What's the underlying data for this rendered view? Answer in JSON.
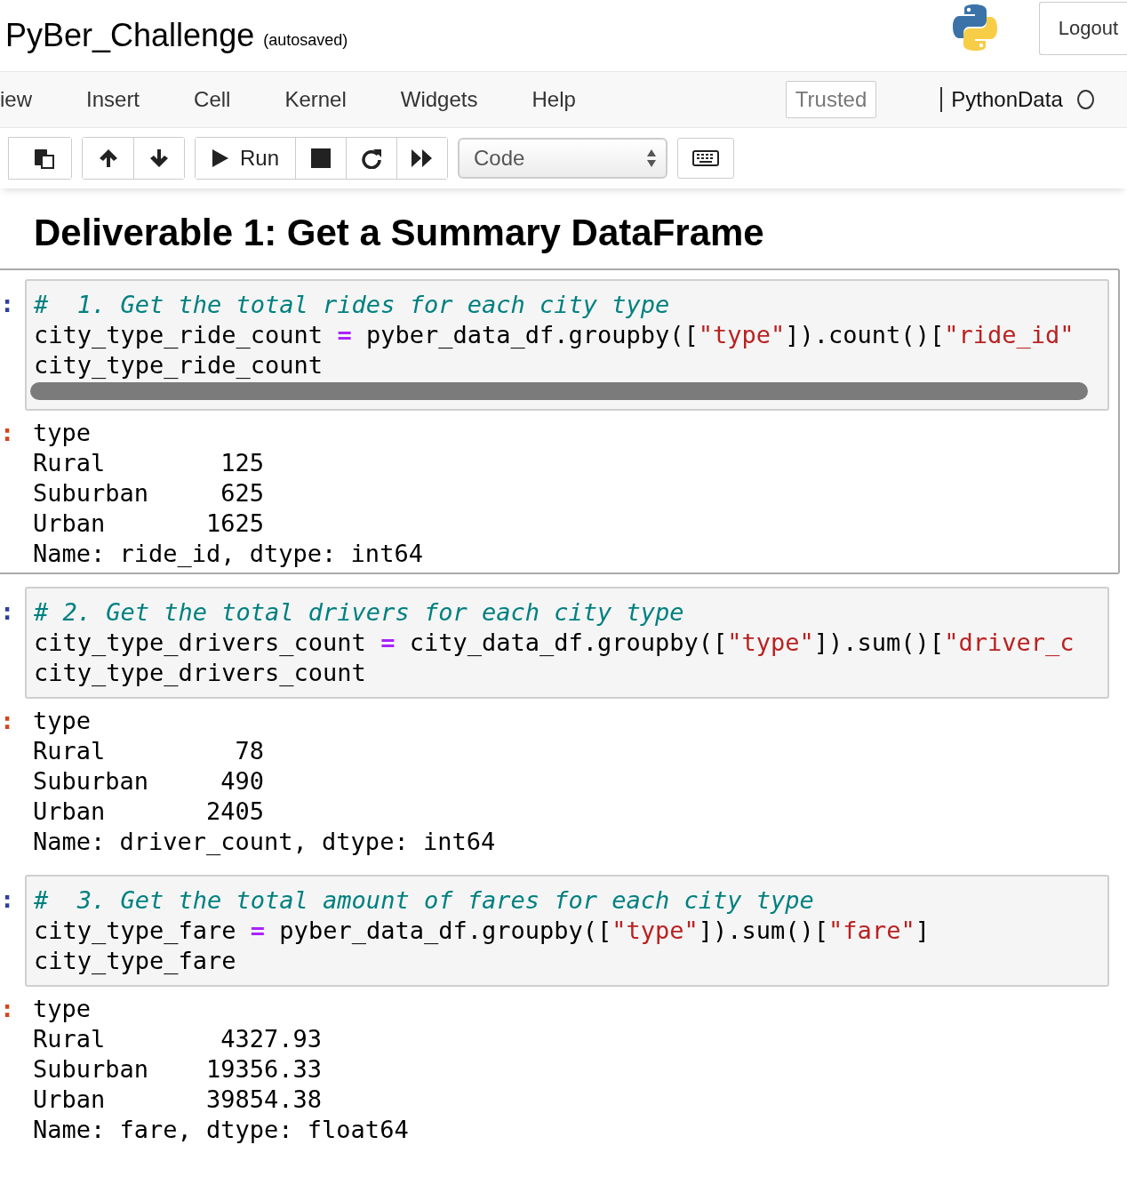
{
  "header": {
    "title": "PyBer_Challenge",
    "save_status": "(autosaved)",
    "logout": "Logout"
  },
  "menu": [
    "iew",
    "Insert",
    "Cell",
    "Kernel",
    "Widgets",
    "Help"
  ],
  "trusted": "Trusted",
  "kernel": "PythonData",
  "toolbar": {
    "run": "Run",
    "cell_type": "Code"
  },
  "heading": "Deliverable 1: Get a Summary DataFrame",
  "cells": [
    {
      "selected": true,
      "scrollbar": true,
      "in_prompt": ":",
      "out_prompt": ":",
      "code": [
        [
          {
            "kind": "comment",
            "text": "#  1. Get the total rides for each city type"
          }
        ],
        [
          {
            "kind": "plain",
            "text": "city_type_ride_count "
          },
          {
            "kind": "operator",
            "text": "="
          },
          {
            "kind": "plain",
            "text": " pyber_data_df.groupby(["
          },
          {
            "kind": "string",
            "text": "\"type\""
          },
          {
            "kind": "plain",
            "text": "]).count()["
          },
          {
            "kind": "string",
            "text": "\"ride_id\""
          }
        ],
        [
          {
            "kind": "plain",
            "text": "city_type_ride_count"
          }
        ]
      ],
      "output": [
        "type",
        "Rural        125",
        "Suburban     625",
        "Urban       1625",
        "Name: ride_id, dtype: int64"
      ]
    },
    {
      "selected": false,
      "scrollbar": false,
      "in_prompt": ":",
      "out_prompt": ":",
      "code": [
        [
          {
            "kind": "comment",
            "text": "# 2. Get the total drivers for each city type"
          }
        ],
        [
          {
            "kind": "plain",
            "text": "city_type_drivers_count "
          },
          {
            "kind": "operator",
            "text": "="
          },
          {
            "kind": "plain",
            "text": " city_data_df.groupby(["
          },
          {
            "kind": "string",
            "text": "\"type\""
          },
          {
            "kind": "plain",
            "text": "]).sum()["
          },
          {
            "kind": "string",
            "text": "\"driver_c"
          }
        ],
        [
          {
            "kind": "plain",
            "text": "city_type_drivers_count"
          }
        ]
      ],
      "output": [
        "type",
        "Rural         78",
        "Suburban     490",
        "Urban       2405",
        "Name: driver_count, dtype: int64"
      ]
    },
    {
      "selected": false,
      "scrollbar": false,
      "in_prompt": ":",
      "out_prompt": ":",
      "code": [
        [
          {
            "kind": "comment",
            "text": "#  3. Get the total amount of fares for each city type"
          }
        ],
        [
          {
            "kind": "plain",
            "text": "city_type_fare "
          },
          {
            "kind": "operator",
            "text": "="
          },
          {
            "kind": "plain",
            "text": " pyber_data_df.groupby(["
          },
          {
            "kind": "string",
            "text": "\"type\""
          },
          {
            "kind": "plain",
            "text": "]).sum()["
          },
          {
            "kind": "string",
            "text": "\"fare\""
          },
          {
            "kind": "plain",
            "text": "]"
          }
        ],
        [
          {
            "kind": "plain",
            "text": "city_type_fare"
          }
        ]
      ],
      "output": [
        "type",
        "Rural        4327.93",
        "Suburban    19356.33",
        "Urban       39854.38",
        "Name: fare, dtype: float64"
      ]
    }
  ]
}
